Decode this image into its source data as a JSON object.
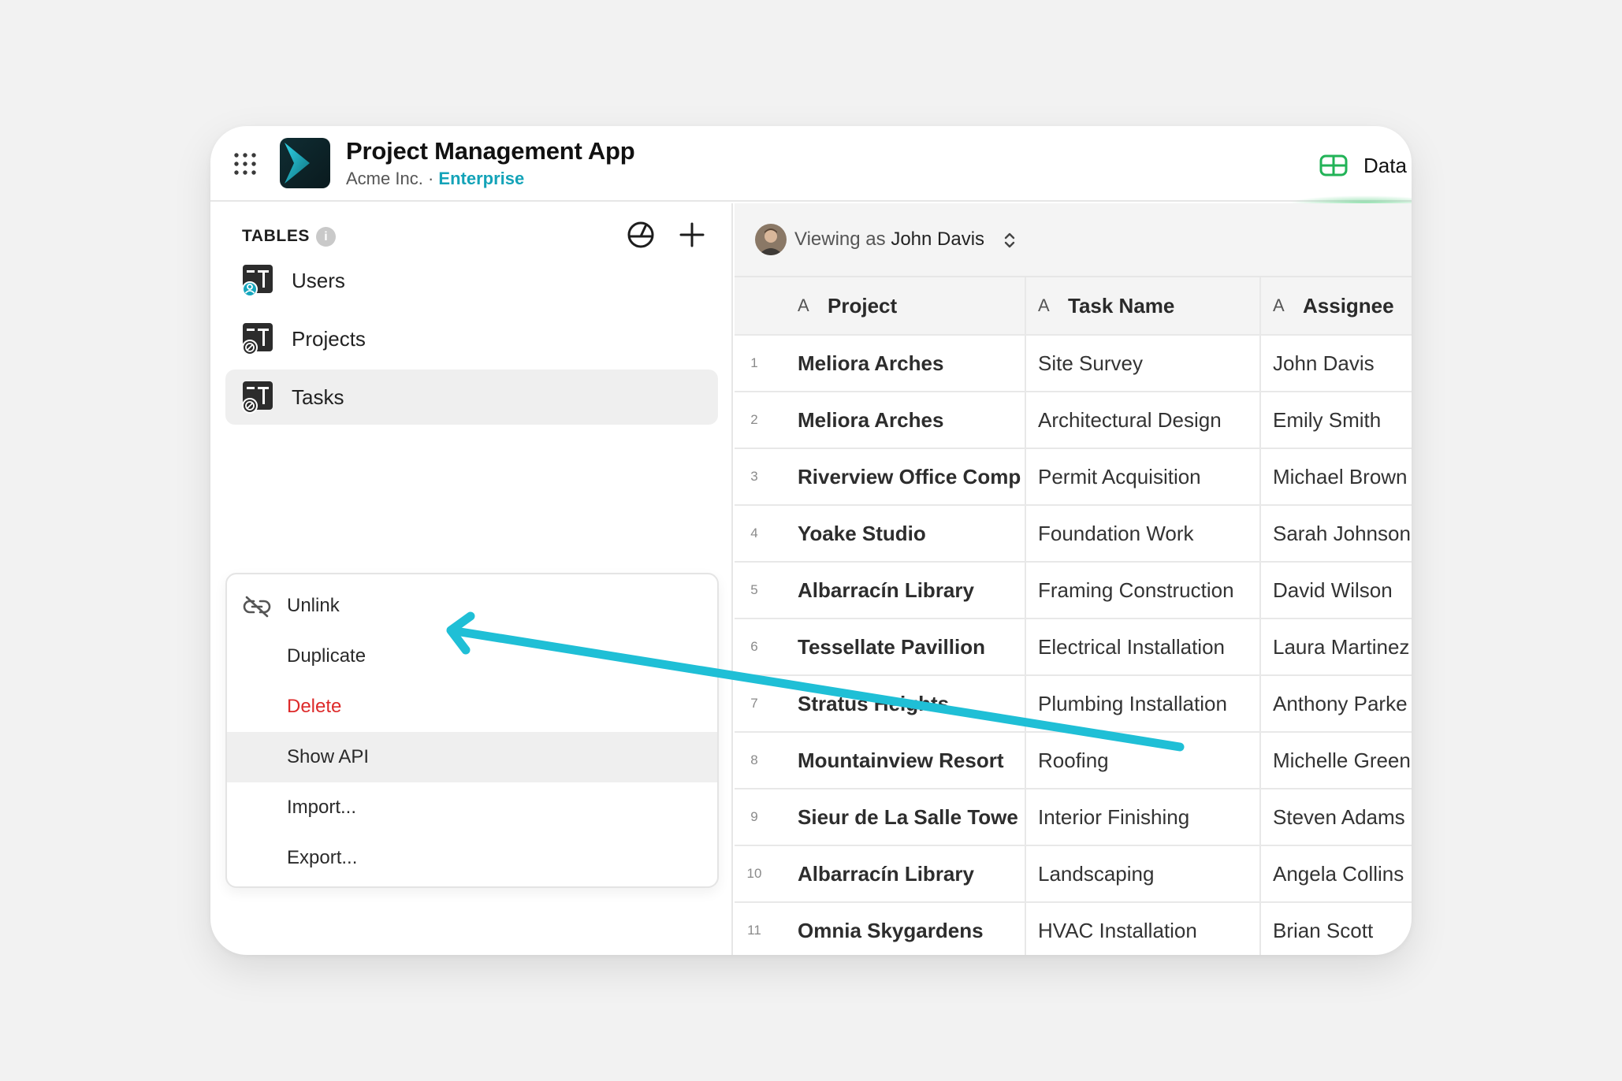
{
  "header": {
    "app_title": "Project Management App",
    "org": "Acme Inc.",
    "separator": "·",
    "plan": "Enterprise",
    "data_tab_label": "Data"
  },
  "sidebar": {
    "section_label": "TABLES",
    "info_icon_text": "i",
    "items": [
      {
        "label": "Users",
        "icon": "table-users-icon"
      },
      {
        "label": "Projects",
        "icon": "table-linked-icon"
      },
      {
        "label": "Tasks",
        "icon": "table-linked-icon",
        "active": true
      }
    ]
  },
  "context_menu": {
    "items": [
      {
        "label": "Unlink",
        "icon": "unlink-icon"
      },
      {
        "label": "Duplicate"
      },
      {
        "label": "Delete",
        "danger": true
      },
      {
        "label": "Show API",
        "highlighted": true
      },
      {
        "label": "Import..."
      },
      {
        "label": "Export..."
      }
    ]
  },
  "view_bar": {
    "prefix": "Viewing as",
    "user": "John Davis"
  },
  "grid": {
    "column_type_icon": "A",
    "columns": [
      "Project",
      "Task Name",
      "Assignee"
    ],
    "rows": [
      {
        "n": "1",
        "project": "Meliora Arches",
        "task": "Site Survey",
        "assignee": "John Davis"
      },
      {
        "n": "2",
        "project": "Meliora Arches",
        "task": "Architectural Design",
        "assignee": "Emily Smith"
      },
      {
        "n": "3",
        "project": "Riverview Office Comp",
        "task": "Permit Acquisition",
        "assignee": "Michael Brown"
      },
      {
        "n": "4",
        "project": "Yoake Studio",
        "task": "Foundation Work",
        "assignee": "Sarah Johnson"
      },
      {
        "n": "5",
        "project": "Albarracín Library",
        "task": "Framing Construction",
        "assignee": "David Wilson"
      },
      {
        "n": "6",
        "project": "Tessellate Pavillion",
        "task": "Electrical Installation",
        "assignee": "Laura Martinez"
      },
      {
        "n": "7",
        "project": "Stratus Heights",
        "task": "Plumbing Installation",
        "assignee": "Anthony Parke"
      },
      {
        "n": "8",
        "project": "Mountainview Resort",
        "task": "Roofing",
        "assignee": "Michelle Green"
      },
      {
        "n": "9",
        "project": "Sieur de La Salle Towe",
        "task": "Interior Finishing",
        "assignee": "Steven Adams"
      },
      {
        "n": "10",
        "project": "Albarracín Library",
        "task": "Landscaping",
        "assignee": "Angela Collins"
      },
      {
        "n": "11",
        "project": "Omnia Skygardens",
        "task": "HVAC Installation",
        "assignee": "Brian Scott"
      }
    ]
  },
  "colors": {
    "accent_teal": "#14a3b8",
    "arrow": "#1fbfd6",
    "danger": "#dd2a2a",
    "data_tab_green": "#22b357"
  }
}
